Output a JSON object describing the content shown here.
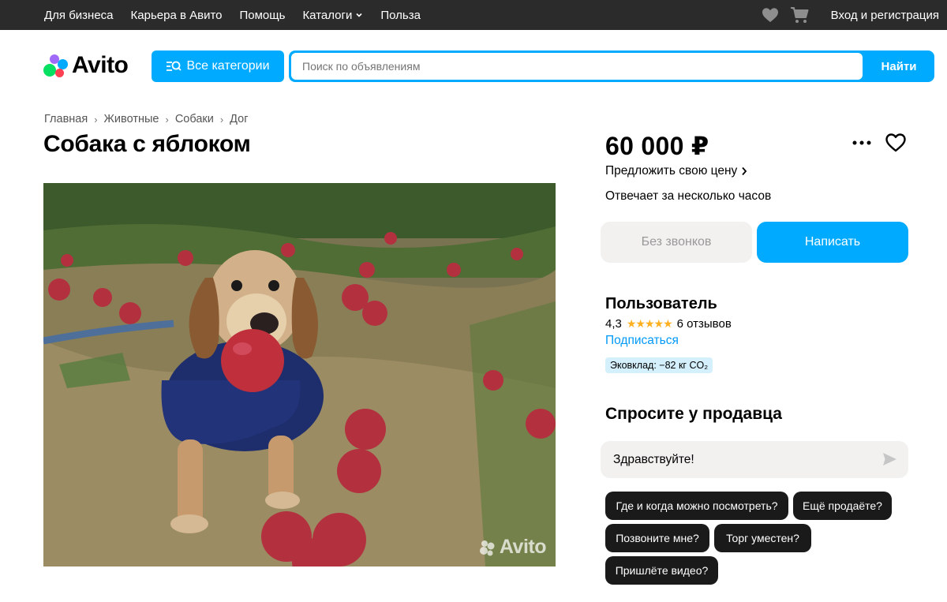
{
  "topbar": {
    "links": [
      "Для бизнеса",
      "Карьера в Авито",
      "Помощь",
      "Каталоги",
      "Польза"
    ],
    "login": "Вход и регистрация"
  },
  "header": {
    "logo": "Avito",
    "categories_button": "Все категории",
    "search_placeholder": "Поиск по объявлениям",
    "search_button": "Найти"
  },
  "breadcrumbs": [
    "Главная",
    "Животные",
    "Собаки",
    "Дог"
  ],
  "listing": {
    "title": "Собака с яблоком",
    "watermark": "Avito"
  },
  "sidebar": {
    "price": "60 000 ₽",
    "offer_price": "Предложить свою цену",
    "response_time": "Отвечает за несколько часов",
    "no_calls_button": "Без звонков",
    "write_button": "Написать"
  },
  "seller": {
    "name": "Пользователь",
    "rating": "4,3",
    "stars": "★★★★★",
    "reviews": "6 отзывов",
    "subscribe": "Подписаться",
    "eco": "Эковклад: −82 кг CO₂"
  },
  "ask": {
    "title": "Спросите у продавца",
    "message": "Здравствуйте!",
    "chips": [
      "Где и когда можно посмотреть?",
      "Ещё продаёте?",
      "Позвоните мне?",
      "Торг уместен?",
      "Пришлёте видео?"
    ]
  },
  "colors": {
    "accent": "#00aaff",
    "topbar": "#2b2b2b",
    "link": "#0099f7",
    "star": "#ffb021"
  }
}
